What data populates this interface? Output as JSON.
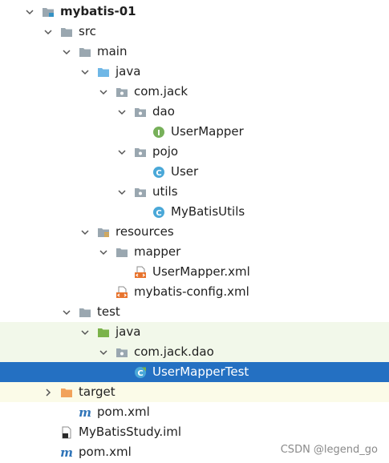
{
  "tree": [
    {
      "label": "mybatis-01",
      "bold": true,
      "expanded": true,
      "icon": "module-folder-icon",
      "level": 0
    },
    {
      "label": "src",
      "expanded": true,
      "icon": "folder-icon",
      "level": 1
    },
    {
      "label": "main",
      "expanded": true,
      "icon": "folder-icon",
      "level": 2
    },
    {
      "label": "java",
      "expanded": true,
      "icon": "source-root-folder-icon",
      "level": 3
    },
    {
      "label": "com.jack",
      "expanded": true,
      "icon": "package-icon",
      "level": 4
    },
    {
      "label": "dao",
      "expanded": true,
      "icon": "package-icon",
      "level": 5
    },
    {
      "label": "UserMapper",
      "icon": "interface-icon",
      "level": 6
    },
    {
      "label": "pojo",
      "expanded": true,
      "icon": "package-icon",
      "level": 5
    },
    {
      "label": "User",
      "icon": "class-icon",
      "level": 6
    },
    {
      "label": "utils",
      "expanded": true,
      "icon": "package-icon",
      "level": 5
    },
    {
      "label": "MyBatisUtils",
      "icon": "class-icon",
      "level": 6
    },
    {
      "label": "resources",
      "expanded": true,
      "icon": "resources-folder-icon",
      "level": 3
    },
    {
      "label": "mapper",
      "expanded": true,
      "icon": "folder-icon",
      "level": 4
    },
    {
      "label": "UserMapper.xml",
      "icon": "xml-file-icon",
      "level": 5
    },
    {
      "label": "mybatis-config.xml",
      "icon": "xml-file-icon",
      "level": 4
    },
    {
      "label": "test",
      "expanded": true,
      "icon": "folder-icon",
      "level": 2
    },
    {
      "label": "java",
      "expanded": true,
      "icon": "test-root-folder-icon",
      "level": 3,
      "bg": "test"
    },
    {
      "label": "com.jack.dao",
      "expanded": true,
      "icon": "package-icon",
      "level": 4,
      "bg": "test"
    },
    {
      "label": "UserMapperTest",
      "icon": "test-class-icon",
      "level": 5,
      "selected": true
    },
    {
      "label": "target",
      "expanded": false,
      "icon": "excluded-folder-icon",
      "level": 1,
      "bg": "excluded"
    },
    {
      "label": "pom.xml",
      "icon": "maven-icon",
      "level": 2
    },
    {
      "label": "MyBatisStudy.iml",
      "icon": "iml-file-icon",
      "level": 1
    },
    {
      "label": "pom.xml",
      "icon": "maven-icon",
      "level": 1
    }
  ],
  "watermark": "CSDN @legend_go",
  "colors": {
    "selection": "#2470c2",
    "test_background": "#f2f8ea",
    "excluded_background": "#fbfbe8",
    "folder": "#9aa7b0",
    "source_folder": "#6fb7e6",
    "test_folder": "#7bb34a",
    "excluded_folder": "#f1a25b",
    "class_icon": "#4aa8d8",
    "interface_icon": "#77b05a"
  }
}
